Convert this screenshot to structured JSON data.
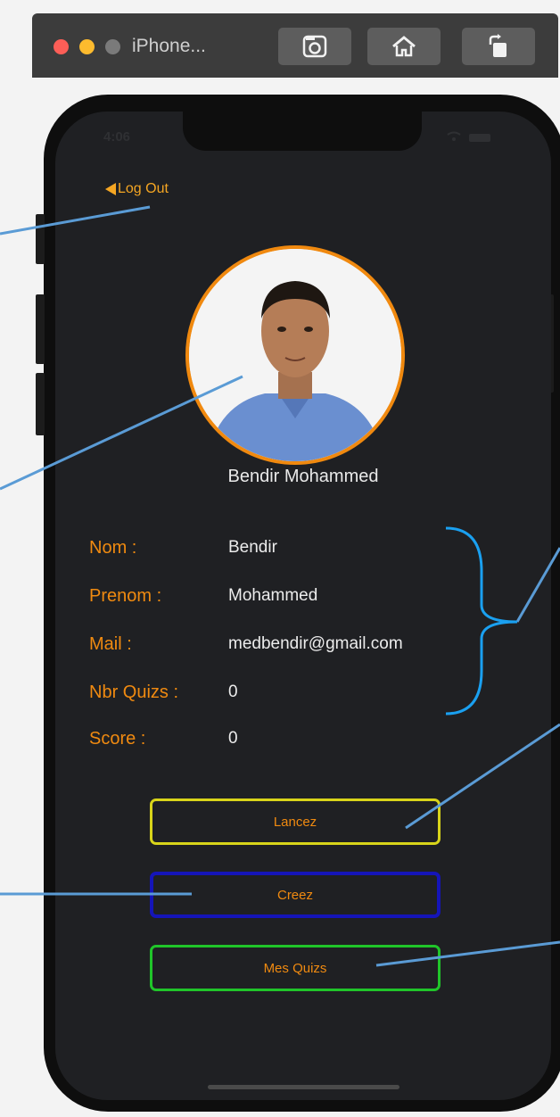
{
  "simulator": {
    "title": "iPhone...",
    "buttons": [
      "screenshot-icon",
      "home-icon",
      "rotate-icon"
    ]
  },
  "status_bar": {
    "time": "4:06"
  },
  "nav": {
    "logout_label": "Log Out"
  },
  "profile": {
    "full_name": "Bendir Mohammed",
    "fields": [
      {
        "label": "Nom :",
        "value": "Bendir"
      },
      {
        "label": "Prenom :",
        "value": "Mohammed"
      },
      {
        "label": "Mail :",
        "value": "medbendir@gmail.com"
      },
      {
        "label": "Nbr Quizs :",
        "value": "0"
      },
      {
        "label": "Score :",
        "value": "0"
      }
    ]
  },
  "actions": {
    "launch_label": "Lancez",
    "create_label": "Creez",
    "my_quizzes_label": "Mes Quizs"
  },
  "colors": {
    "accent_orange": "#f08a10",
    "launch_border": "#d8d41a",
    "create_border": "#1515b8",
    "my_quizzes_border": "#20c52a",
    "annotation_line": "#5a9bd5",
    "bracket": "#1aa0f0"
  }
}
